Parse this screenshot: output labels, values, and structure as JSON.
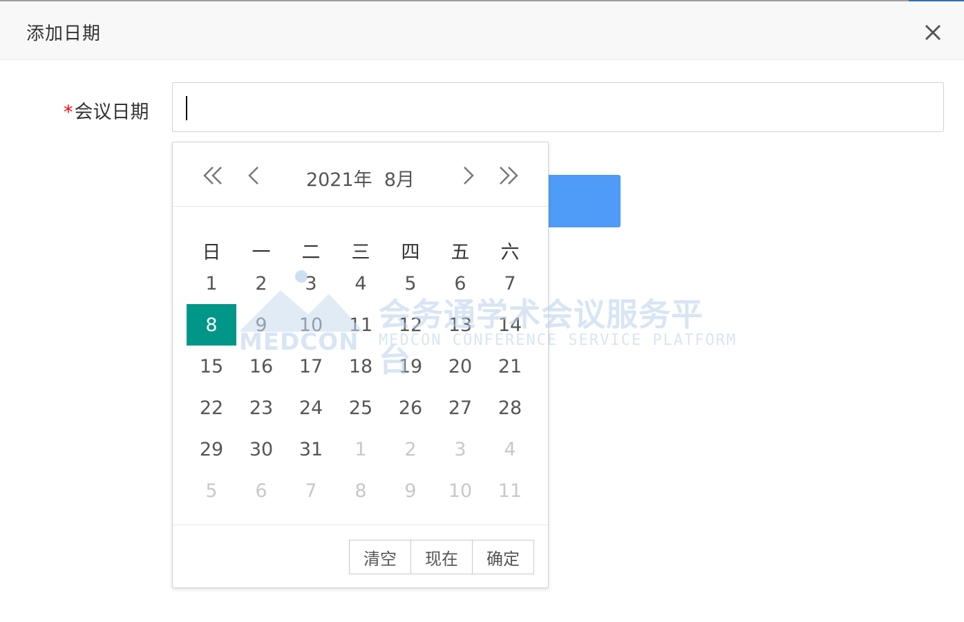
{
  "dialog": {
    "title": "添加日期",
    "close_icon": "close-icon"
  },
  "form": {
    "required_mark": "*",
    "date_label": "会议日期",
    "date_value": ""
  },
  "picker": {
    "year_label": "2021年",
    "month_label": "8月",
    "nav_icons": [
      "double-chevron-left-icon",
      "chevron-left-icon",
      "chevron-right-icon",
      "double-chevron-right-icon"
    ],
    "weekdays": [
      "日",
      "一",
      "二",
      "三",
      "四",
      "五",
      "六"
    ],
    "weeks": [
      [
        {
          "d": "1",
          "other": false
        },
        {
          "d": "2",
          "other": false
        },
        {
          "d": "3",
          "other": false
        },
        {
          "d": "4",
          "other": false
        },
        {
          "d": "5",
          "other": false
        },
        {
          "d": "6",
          "other": false
        },
        {
          "d": "7",
          "other": false
        }
      ],
      [
        {
          "d": "8",
          "other": false,
          "selected": true
        },
        {
          "d": "9",
          "other": false
        },
        {
          "d": "10",
          "other": false
        },
        {
          "d": "11",
          "other": false
        },
        {
          "d": "12",
          "other": false
        },
        {
          "d": "13",
          "other": false
        },
        {
          "d": "14",
          "other": false
        }
      ],
      [
        {
          "d": "15",
          "other": false
        },
        {
          "d": "16",
          "other": false
        },
        {
          "d": "17",
          "other": false
        },
        {
          "d": "18",
          "other": false
        },
        {
          "d": "19",
          "other": false
        },
        {
          "d": "20",
          "other": false
        },
        {
          "d": "21",
          "other": false
        }
      ],
      [
        {
          "d": "22",
          "other": false
        },
        {
          "d": "23",
          "other": false
        },
        {
          "d": "24",
          "other": false
        },
        {
          "d": "25",
          "other": false
        },
        {
          "d": "26",
          "other": false
        },
        {
          "d": "27",
          "other": false
        },
        {
          "d": "28",
          "other": false
        }
      ],
      [
        {
          "d": "29",
          "other": false
        },
        {
          "d": "30",
          "other": false
        },
        {
          "d": "31",
          "other": false
        },
        {
          "d": "1",
          "other": true
        },
        {
          "d": "2",
          "other": true
        },
        {
          "d": "3",
          "other": true
        },
        {
          "d": "4",
          "other": true
        }
      ],
      [
        {
          "d": "5",
          "other": true
        },
        {
          "d": "6",
          "other": true
        },
        {
          "d": "7",
          "other": true
        },
        {
          "d": "8",
          "other": true
        },
        {
          "d": "9",
          "other": true
        },
        {
          "d": "10",
          "other": true
        },
        {
          "d": "11",
          "other": true
        }
      ]
    ],
    "footer": {
      "clear_label": "清空",
      "now_label": "现在",
      "confirm_label": "确定"
    }
  },
  "watermark": {
    "brand": "MEDCON",
    "cn_text": "会务通学术会议服务平台",
    "en_text": "MEDCON CONFERENCE SERVICE PLATFORM"
  },
  "colors": {
    "selected_day": "#009688",
    "primary_button": "#4e9cf7",
    "required": "#ff0000"
  }
}
